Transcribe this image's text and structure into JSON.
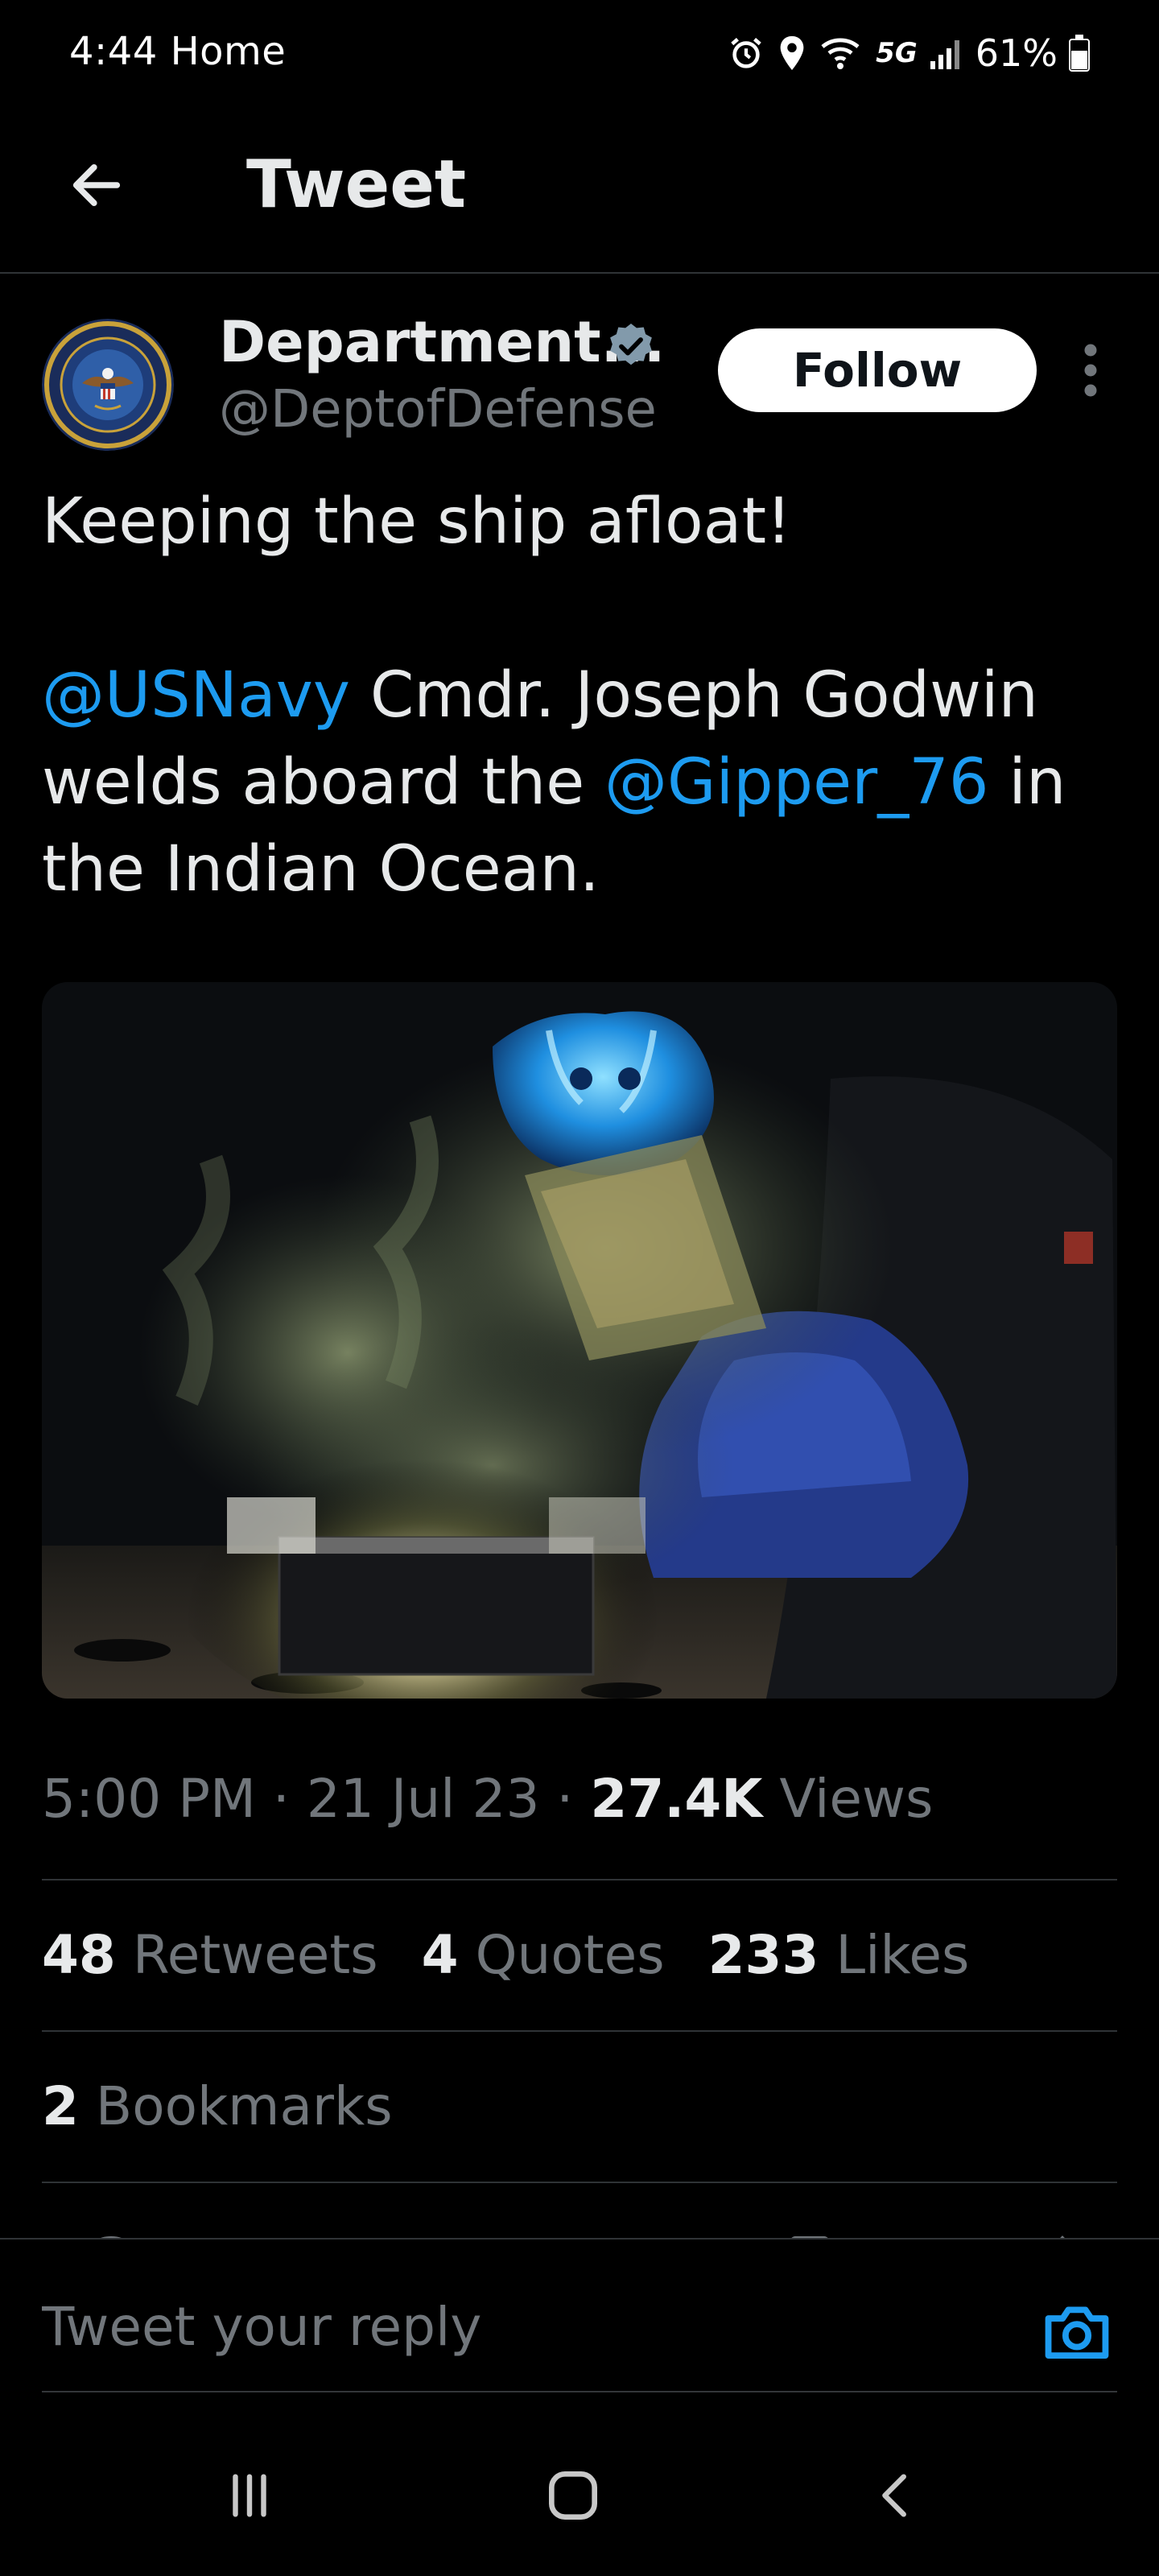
{
  "status_bar": {
    "time": "4:44",
    "home_label": "Home",
    "network": "5G",
    "battery": "61%"
  },
  "header": {
    "title": "Tweet"
  },
  "author": {
    "name": "Department...",
    "handle": "@DeptofDefense",
    "follow_label": "Follow"
  },
  "tweet": {
    "line1": "Keeping the ship afloat!",
    "mention1": "@USNavy",
    "text_a": " Cmdr. Joseph Godwin welds aboard the ",
    "mention2": "@Gipper_76",
    "text_b": " in the Indian Ocean."
  },
  "meta": {
    "time": "5:00 PM",
    "sep": " · ",
    "date": "21 Jul 23",
    "views_count": "27.4K",
    "views_label": " Views"
  },
  "stats": {
    "retweets_count": "48",
    "retweets_label": " Retweets",
    "quotes_count": "4",
    "quotes_label": " Quotes",
    "likes_count": "233",
    "likes_label": " Likes"
  },
  "bookmarks": {
    "count": "2",
    "label": " Bookmarks"
  },
  "reply": {
    "placeholder": "Tweet your reply"
  },
  "icons": {
    "back": "arrow-left-icon",
    "verified": "verified-badge-icon",
    "more": "more-vertical-icon",
    "camera": "camera-icon",
    "recents": "recents-icon",
    "home": "home-icon",
    "nav_back": "chevron-left-icon"
  },
  "colors": {
    "background": "#000000",
    "link": "#1d9bf0",
    "muted": "#71767b",
    "text": "#e7e9ea",
    "divider": "#2f3336"
  }
}
